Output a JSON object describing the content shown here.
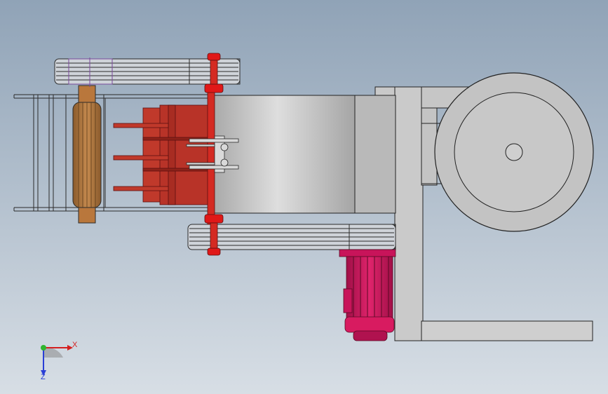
{
  "viewport": {
    "background_top": "#90a3b7",
    "background_bottom": "#d7dee5"
  },
  "triad": {
    "x_label": "X",
    "z_label": "Z",
    "x_color": "#d41f1f",
    "y_color": "#2fb52f",
    "z_color": "#2a3fd6"
  },
  "model": {
    "housing_color": "#c4c4c4",
    "rotor_color": "#c0392b",
    "bolt_color": "#e01818",
    "roller_color": "#b9773c",
    "motor_color": "#c8145a",
    "edge_color": "#222222"
  }
}
